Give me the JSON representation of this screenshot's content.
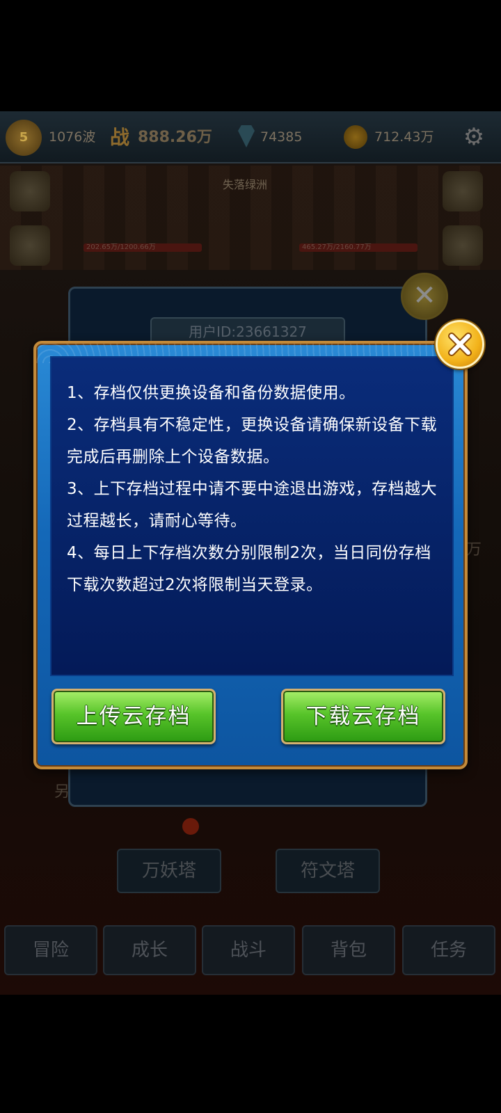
{
  "topbar": {
    "level": "5",
    "wave": "1076波",
    "power_icon_label": "战",
    "power": "888.26万",
    "gems": "74385",
    "gold": "712.43万"
  },
  "scene": {
    "title": "失落绿洲",
    "hp_left": "202.65万/1200.66万",
    "hp_right": "465.27万/2160.77万"
  },
  "background_panel": {
    "user_id": "用户ID:23661327"
  },
  "towers": [
    "万妖塔",
    "符文塔"
  ],
  "bottom_nav": [
    "冒险",
    "成长",
    "战斗",
    "背包",
    "任务"
  ],
  "dialog": {
    "rules": [
      "1、存档仅供更换设备和备份数据使用。",
      "2、存档具有不稳定性，更换设备请确保新设备下载完成后再删除上个设备数据。",
      "3、上下存档过程中请不要中途退出游戏，存档越大过程越长，请耐心等待。",
      "4、每日上下存档次数分别限制2次，当日同份存档下载次数超过2次将限制当天登录。"
    ],
    "upload_label": "上传云存档",
    "download_label": "下载云存档"
  },
  "colors": {
    "dialog_blue": "#1468b8",
    "content_navy": "#062266",
    "button_green": "#58c42a",
    "close_gold": "#f2b21a"
  },
  "icons": {
    "close": "close-x-icon",
    "settings": "gear-icon",
    "gem": "gem-icon",
    "gold": "coin-icon"
  }
}
